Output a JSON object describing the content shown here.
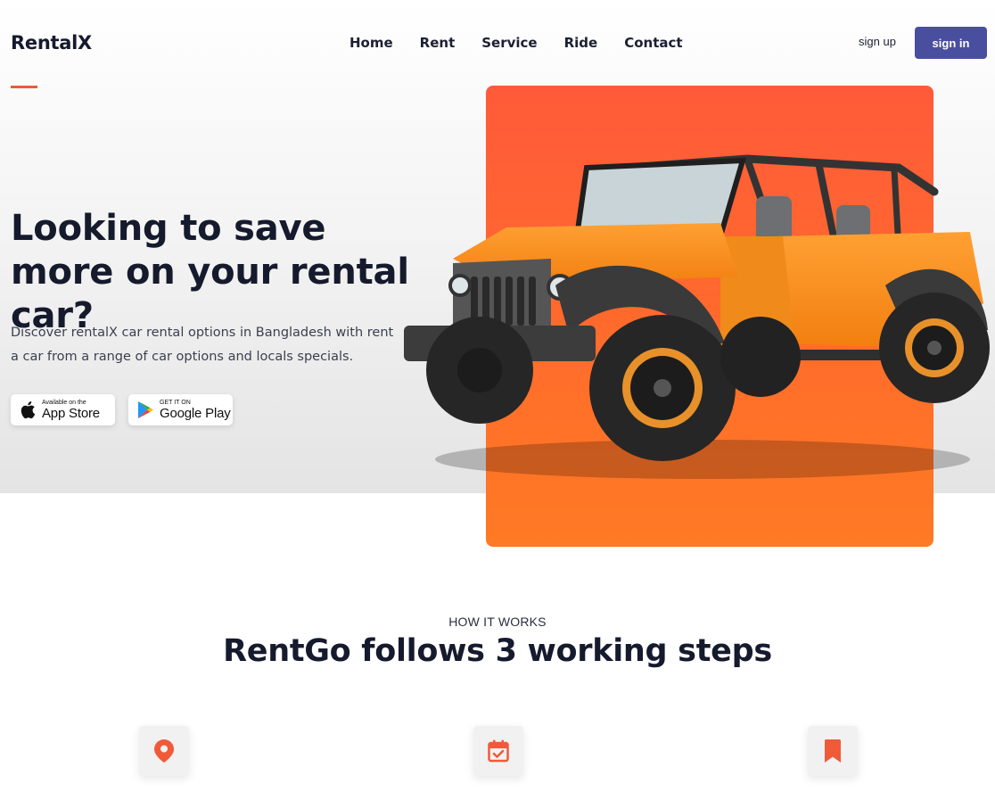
{
  "brand": {
    "logo": "RentalX"
  },
  "nav": {
    "items": [
      {
        "label": "Home"
      },
      {
        "label": "Rent"
      },
      {
        "label": "Service"
      },
      {
        "label": "Ride"
      },
      {
        "label": "Contact"
      }
    ]
  },
  "auth": {
    "signup_label": "sign up",
    "signin_label": "sign in"
  },
  "hero": {
    "headline": "Looking to save more on your rental car?",
    "subtext": "Discover rentalX car rental options in Bangladesh with rent a car from a range of car options and locals specials.",
    "app_store": {
      "small": "Available on the",
      "big": "App Store"
    },
    "google_play": {
      "small": "GET IT ON",
      "big": "Google Play"
    }
  },
  "how_it_works": {
    "label": "HOW IT WORKS",
    "title": "RentGo follows 3 working steps",
    "steps": [
      {
        "icon": "location-pin-icon"
      },
      {
        "icon": "calendar-check-icon"
      },
      {
        "icon": "bookmark-icon"
      }
    ]
  },
  "colors": {
    "accent": "#f05a38",
    "primary_button": "#4a4e9e",
    "orange_card": "#ff6a2c",
    "text_dark": "#151a2d"
  }
}
